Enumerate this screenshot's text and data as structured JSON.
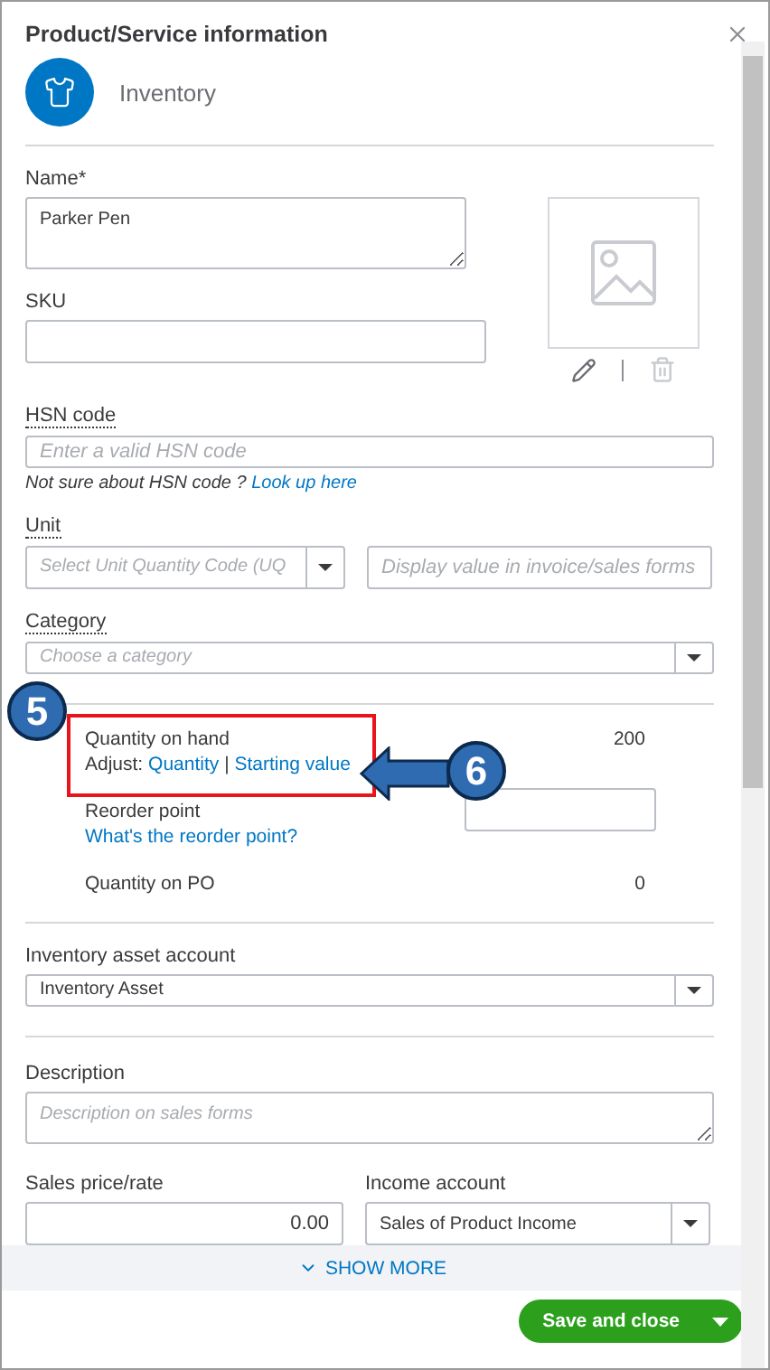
{
  "dialog": {
    "title": "Product/Service information"
  },
  "item_type": {
    "label": "Inventory"
  },
  "name": {
    "label": "Name*",
    "value": "Parker Pen"
  },
  "sku": {
    "label": "SKU"
  },
  "hsn": {
    "label": "HSN code",
    "placeholder": "Enter a valid HSN code",
    "hint": "Not sure about HSN code ?",
    "link": "Look up here"
  },
  "unit": {
    "label": "Unit",
    "placeholder": "Select Unit Quantity Code (UQ",
    "display_placeholder": "Display value in invoice/sales forms"
  },
  "category": {
    "label": "Category",
    "placeholder": "Choose a category"
  },
  "quantity_on_hand": {
    "label": "Quantity on hand",
    "value": "200",
    "adjust_label": "Adjust:",
    "links": [
      "Quantity",
      "Starting value"
    ],
    "separator": "|"
  },
  "reorder_point": {
    "label": "Reorder point",
    "link": "What's the reorder point?"
  },
  "quantity_on_po": {
    "label": "Quantity on PO",
    "value": "0"
  },
  "inventory_asset_account": {
    "label": "Inventory asset account",
    "value": "Inventory Asset"
  },
  "description": {
    "label": "Description",
    "placeholder": "Description on sales forms"
  },
  "sales_price": {
    "label": "Sales price/rate",
    "value": "0.00"
  },
  "income_account": {
    "label": "Income account",
    "value": "Sales of Product Income"
  },
  "show_more": {
    "label": "SHOW MORE"
  },
  "save_button": {
    "label": "Save and close"
  },
  "callouts": [
    {
      "label": "5"
    },
    {
      "label": "6"
    }
  ]
}
